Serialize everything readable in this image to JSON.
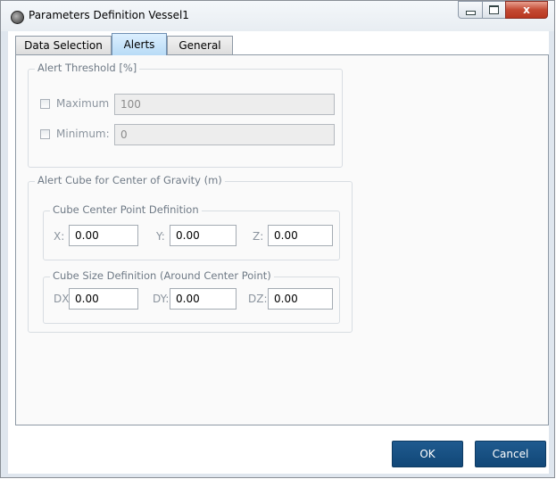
{
  "window": {
    "title": "Parameters Definition Vessel1",
    "close_glyph": "x",
    "icons": [
      "app-icon",
      "minimize-icon",
      "maximize-icon",
      "close-icon"
    ]
  },
  "tabs": [
    {
      "label": "Data Selection",
      "selected": false
    },
    {
      "label": "Alerts",
      "selected": true
    },
    {
      "label": "General",
      "selected": false
    }
  ],
  "alert_threshold": {
    "legend": "Alert Threshold [%]",
    "maximum": {
      "label": "Maximum",
      "checked": false,
      "value": "100"
    },
    "minimum": {
      "label": "Minimum:",
      "checked": false,
      "value": "0"
    }
  },
  "alert_cube": {
    "legend": "Alert Cube for Center of Gravity (m)",
    "center": {
      "legend": "Cube Center Point Definition",
      "x": {
        "label": "X:",
        "value": "0.00"
      },
      "y": {
        "label": "Y:",
        "value": "0.00"
      },
      "z": {
        "label": "Z:",
        "value": "0.00"
      }
    },
    "size": {
      "legend": "Cube Size Definition (Around Center Point)",
      "dx": {
        "label": "DX:",
        "value": "0.00"
      },
      "dy": {
        "label": "DY:",
        "value": "0.00"
      },
      "dz": {
        "label": "DZ:",
        "value": "0.00"
      }
    }
  },
  "buttons": {
    "ok": "OK",
    "cancel": "Cancel"
  },
  "colors": {
    "primary_button": "#1a5287",
    "active_tab": "#c6e3fa"
  }
}
